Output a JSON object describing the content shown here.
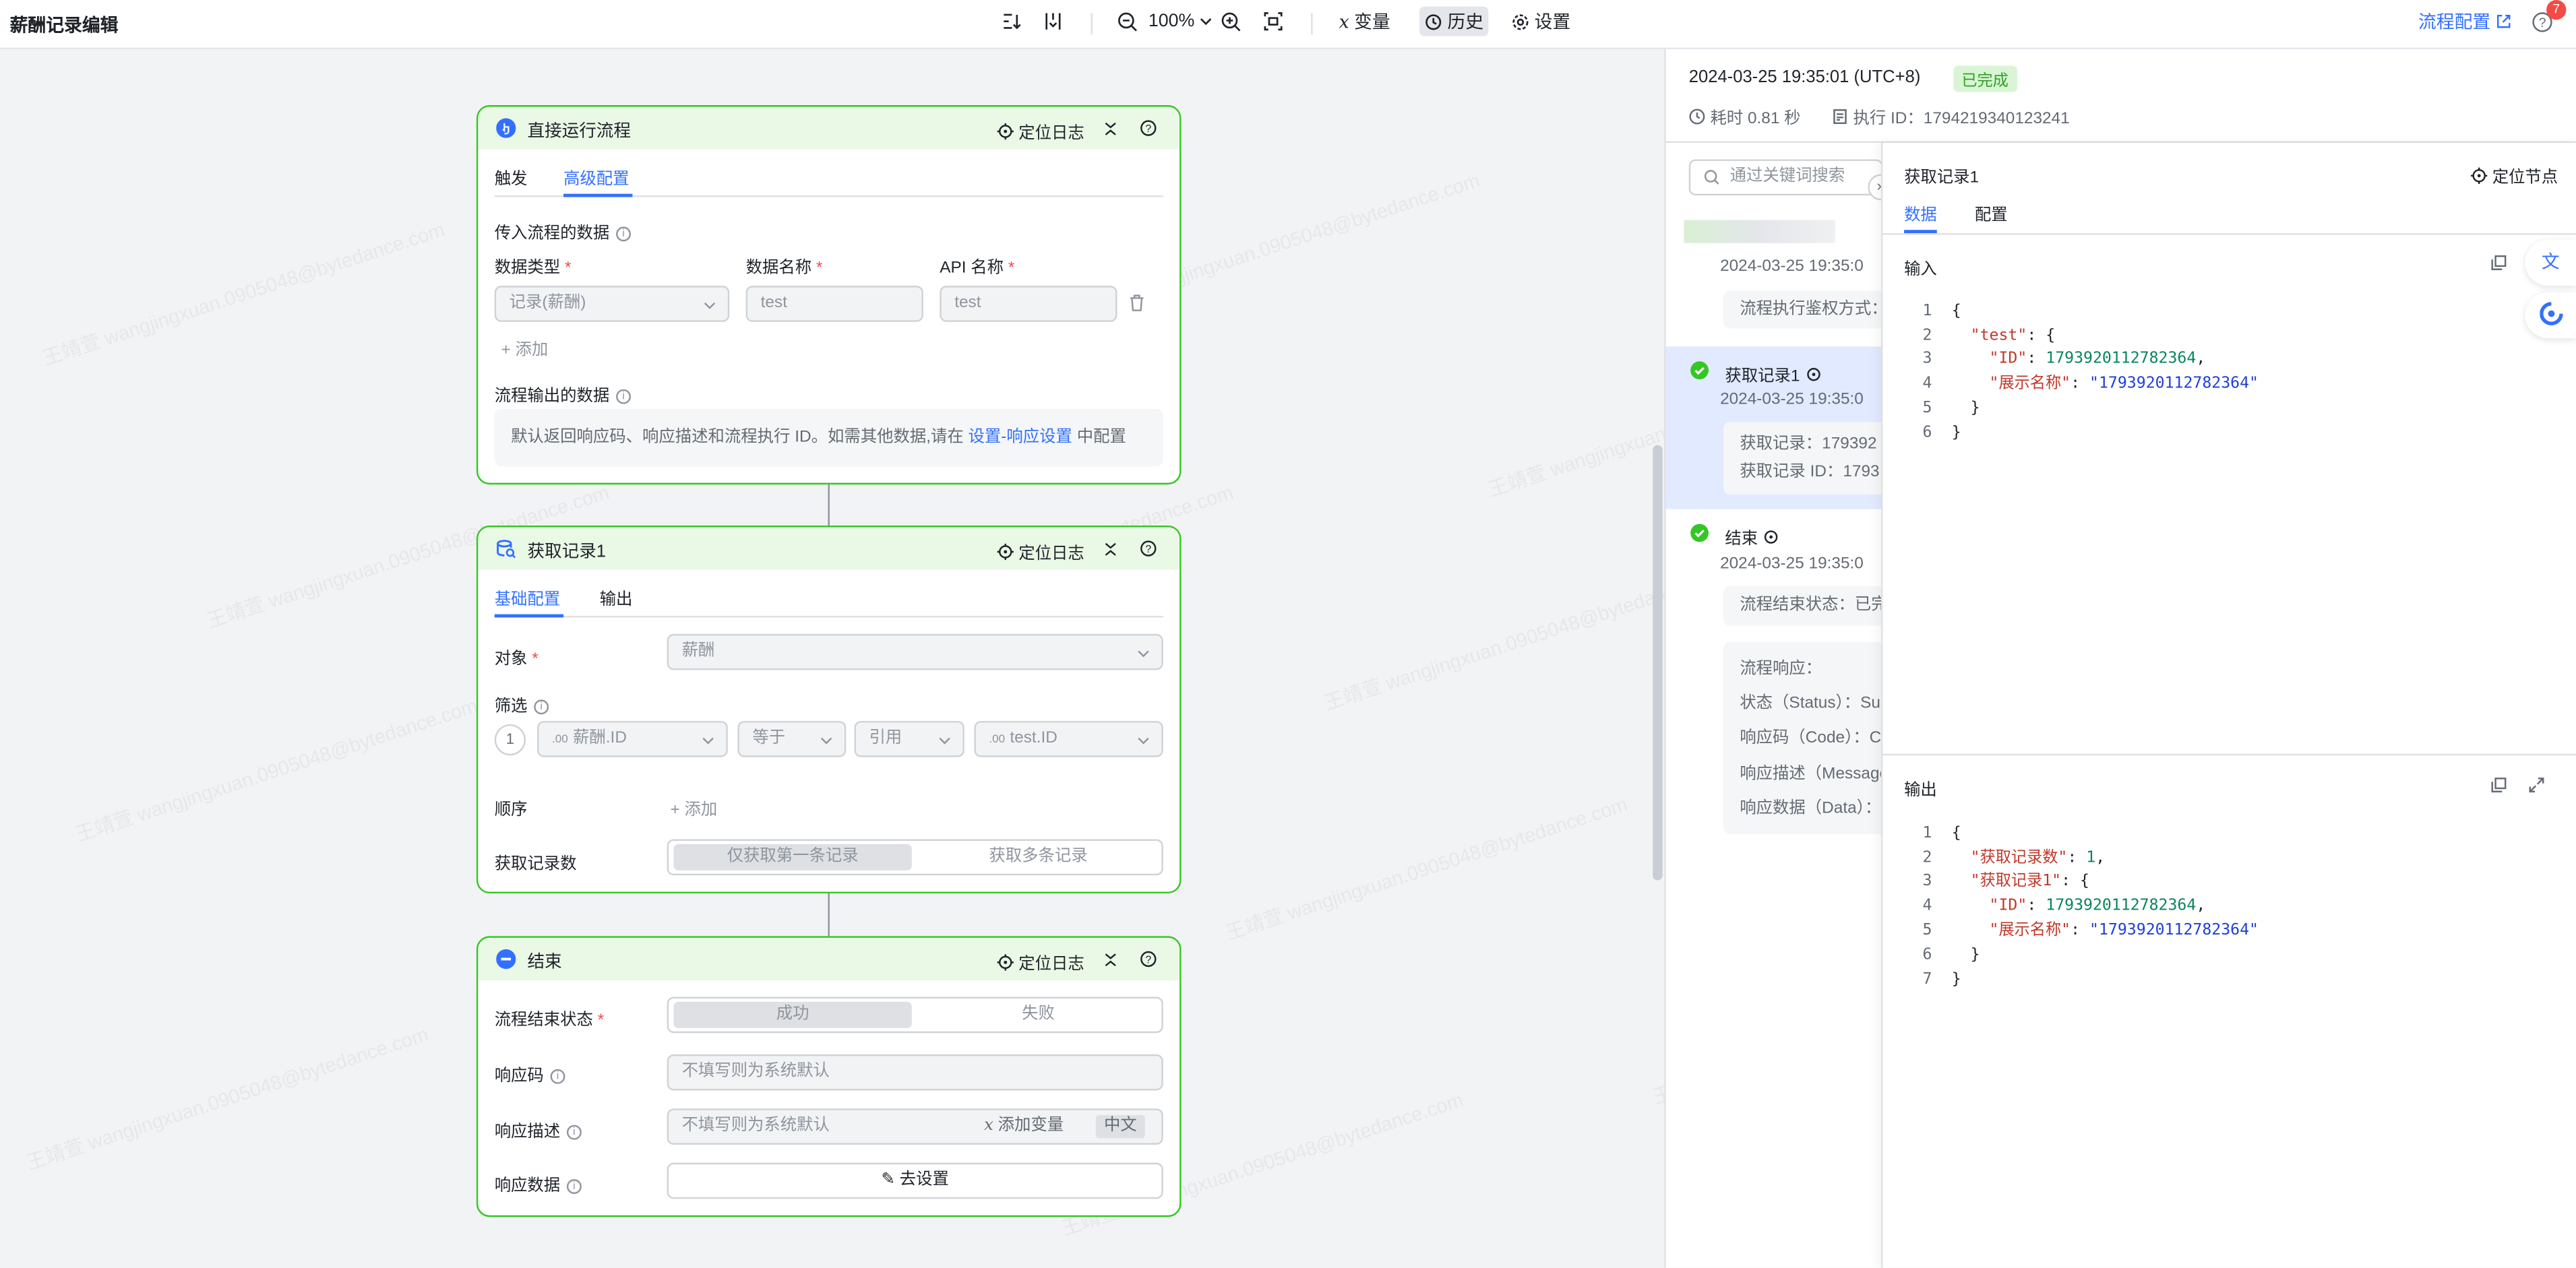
{
  "header": {
    "title": "薪酬记录编辑",
    "zoom": "100%",
    "variables_label": "变量",
    "history_label": "历史",
    "settings_label": "设置",
    "flow_config_label": "流程配置",
    "notification_count": "7"
  },
  "nodes": {
    "run": {
      "title": "直接运行流程",
      "locate_label": "定位日志",
      "tabs": [
        "触发",
        "高级配置"
      ],
      "input_section": "传入流程的数据",
      "col_type": "数据类型",
      "col_name": "数据名称",
      "col_api": "API 名称",
      "type_value": "记录(薪酬)",
      "name_value": "test",
      "api_value": "test",
      "add_label": "+ 添加",
      "output_section": "流程输出的数据",
      "output_note_prefix": "默认返回响应码、响应描述和流程执行 ID。如需其他数据,请在",
      "output_note_link": "设置-响应设置",
      "output_note_suffix": "中配置"
    },
    "get": {
      "title": "获取记录1",
      "locate_label": "定位日志",
      "tabs": [
        "基础配置",
        "输出"
      ],
      "object_label": "对象",
      "object_value": "薪酬",
      "filter_label": "筛选",
      "filter_index": "1",
      "filter_field": "薪酬.ID",
      "filter_field_prefix": ".00",
      "filter_op": "等于",
      "filter_ref": "引用",
      "filter_value": "test.ID",
      "filter_value_prefix": ".00",
      "order_label": "顺序",
      "order_add": "+ 添加",
      "count_label": "获取记录数",
      "count_opt1": "仅获取第一条记录",
      "count_opt2": "获取多条记录"
    },
    "end": {
      "title": "结束",
      "locate_label": "定位日志",
      "status_label": "流程结束状态",
      "status_opt1": "成功",
      "status_opt2": "失败",
      "code_label": "响应码",
      "code_placeholder": "不填写则为系统默认",
      "desc_label": "响应描述",
      "desc_placeholder": "不填写则为系统默认",
      "desc_add_var": "添加变量",
      "desc_lang": "中文",
      "data_label": "响应数据",
      "data_button": "去设置"
    }
  },
  "run_panel": {
    "timestamp": "2024-03-25 19:35:01 (UTC+8)",
    "status": "已完成",
    "duration": "耗时 0.81 秒",
    "exec_id": "执行 ID：1794219340123241",
    "search_placeholder": "通过关键词搜索",
    "steps": [
      {
        "time": "2024-03-25 19:35:0",
        "lines": [
          "流程执行鉴权方式："
        ]
      },
      {
        "name": "获取记录1",
        "time": "2024-03-25 19:35:0",
        "lines": [
          "获取记录：179392",
          "获取记录 ID：1793"
        ]
      },
      {
        "name": "结束",
        "time": "2024-03-25 19:35:0",
        "lines": [
          "流程结束状态：已完"
        ],
        "response_title": "流程响应：",
        "response_lines": [
          "状态（Status）：Su",
          "响应码（Code）：C",
          "响应描述（Message",
          "响应数据（Data）："
        ]
      }
    ]
  },
  "detail": {
    "title": "获取记录1",
    "locate_label": "定位节点",
    "tabs": [
      "数据",
      "配置"
    ],
    "input_label": "输入",
    "output_label": "输出",
    "input_json": {
      "test": {
        "ID": "1793920112782364",
        "展示名称": "1793920112782364"
      }
    },
    "output_json": {
      "获取记录数": 1,
      "获取记录1": {
        "ID": "1793920112782364",
        "展示名称": "1793920112782364"
      }
    }
  },
  "watermark": "王靖萱 wangjingxuan.0905048@bytedance.com",
  "colors": {
    "accent": "#3370ff",
    "node_border": "#34c724",
    "node_header": "#eaf8e6",
    "required": "#f54a45"
  }
}
